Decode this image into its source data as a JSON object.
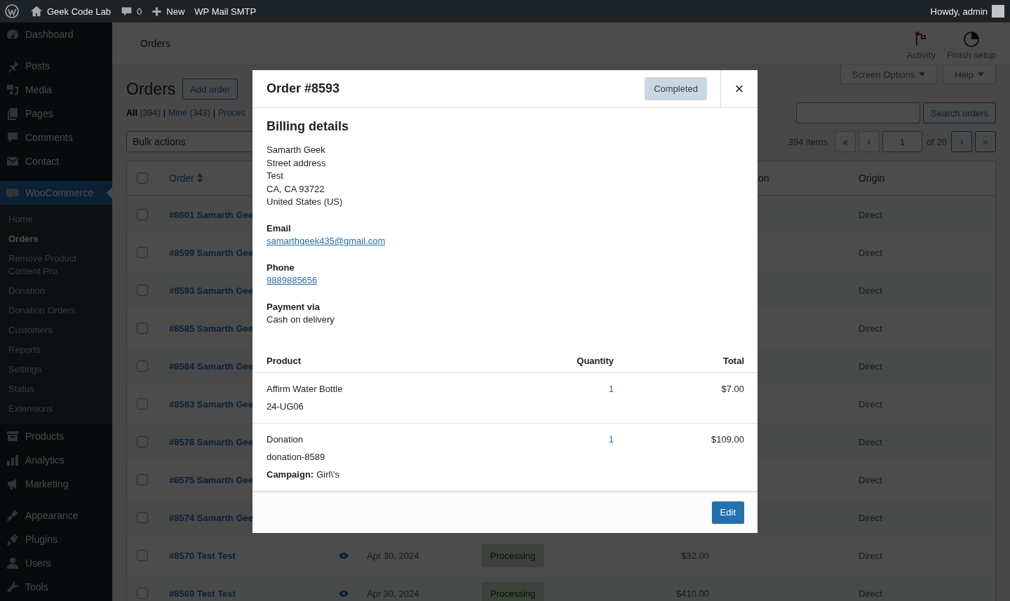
{
  "admin_bar": {
    "site": "Geek Code Lab",
    "comments": "0",
    "new": "New",
    "plugin": "WP Mail SMTP",
    "greeting": "Howdy, admin"
  },
  "sidebar": {
    "groups": [
      [
        {
          "label": "Dashboard",
          "selected": false
        }
      ],
      [
        {
          "label": "Posts",
          "selected": false
        },
        {
          "label": "Media",
          "selected": false
        },
        {
          "label": "Pages",
          "selected": false
        },
        {
          "label": "Comments",
          "selected": false
        },
        {
          "label": "Contact",
          "selected": false
        }
      ],
      [
        {
          "label": "WooCommerce",
          "selected": true,
          "children": [
            {
              "label": "Home",
              "selected": false
            },
            {
              "label": "Orders",
              "selected": true
            },
            {
              "label": "Remove Product Content Pro",
              "selected": false
            },
            {
              "label": "Donation",
              "selected": false
            },
            {
              "label": "Donation Orders",
              "selected": false
            },
            {
              "label": "Customers",
              "selected": false
            },
            {
              "label": "Reports",
              "selected": false
            },
            {
              "label": "Settings",
              "selected": false
            },
            {
              "label": "Status",
              "selected": false
            },
            {
              "label": "Extensions",
              "selected": false
            }
          ]
        },
        {
          "label": "Products",
          "selected": false
        },
        {
          "label": "Analytics",
          "selected": false
        },
        {
          "label": "Marketing",
          "selected": false
        }
      ],
      [
        {
          "label": "Appearance",
          "selected": false
        },
        {
          "label": "Plugins",
          "selected": false
        },
        {
          "label": "Users",
          "selected": false
        },
        {
          "label": "Tools",
          "selected": false
        }
      ]
    ]
  },
  "header": {
    "title": "Orders",
    "actions": [
      {
        "label": "Activity",
        "unread": true
      },
      {
        "label": "Finish setup",
        "unread": false
      }
    ]
  },
  "screen_meta": [
    "Screen Options",
    "Help"
  ],
  "page": {
    "title": "Orders",
    "add_button": "Add order"
  },
  "filters": {
    "separator": "|",
    "items": [
      {
        "label": "All",
        "count": "(394)",
        "selected": true
      },
      {
        "label": "Mine",
        "count": "(343)",
        "selected": false
      },
      {
        "label": "Proces",
        "selected": false
      }
    ]
  },
  "bulk_actions": "Bulk actions",
  "search": {
    "button": "Search orders"
  },
  "pagination": {
    "items": "394 items",
    "page": "1",
    "of": "of 20",
    "buttons": [
      {
        "label": "«",
        "disabled": true
      },
      {
        "label": "‹",
        "disabled": true
      },
      {
        "label": "›",
        "disabled": false
      },
      {
        "label": "»",
        "disabled": false
      }
    ]
  },
  "table": {
    "select_all_checked": false,
    "columns": [
      {
        "label": "Order",
        "sortable": true
      },
      {
        "label": "on"
      },
      {
        "label": "Origin"
      }
    ],
    "rows": [
      {
        "order": "#8601 Samarth Gee",
        "origin": "Direct",
        "checked": false
      },
      {
        "order": "#8599 Samarth Gee",
        "origin": "Direct",
        "checked": false
      },
      {
        "order": "#8593 Samarth Gee",
        "origin": "Direct",
        "checked": false
      },
      {
        "order": "#8585 Samarth Gee",
        "origin": "Direct",
        "checked": false
      },
      {
        "order": "#8584 Samarth Gee",
        "origin": "Direct",
        "checked": false
      },
      {
        "order": "#8583 Samarth Gee",
        "origin": "Direct",
        "checked": false
      },
      {
        "order": "#8576 Samarth Gee",
        "origin": "Direct",
        "checked": false
      },
      {
        "order": "#8575 Samarth Gee",
        "origin": "Direct",
        "checked": false
      },
      {
        "order": "#8574 Samarth Gee",
        "origin": "Direct",
        "checked": false
      },
      {
        "order": "#8570 Test Test",
        "date": "Apr 30, 2024",
        "status": "Processing",
        "total": "$32.00",
        "origin": "Direct",
        "checked": false
      },
      {
        "order": "#8569 Test Test",
        "date": "Apr 30, 2024",
        "status": "Processing",
        "total": "$410.00",
        "origin": "Direct",
        "checked": false
      }
    ]
  },
  "modal": {
    "title": "Order #8593",
    "status": "Completed",
    "close": "×",
    "billing_heading": "Billing details",
    "address": [
      "Samarth Geek",
      "Street address",
      "Test",
      "CA, CA 93722",
      "United States (US)"
    ],
    "fields": [
      {
        "label": "Email",
        "value": "samarthgeek435@gmail.com",
        "kind": "link"
      },
      {
        "label": "Phone",
        "value": "9889885656",
        "kind": "link"
      },
      {
        "label": "Payment via",
        "value": "Cash on delivery",
        "kind": "text"
      }
    ],
    "items_columns": [
      "Product",
      "Quantity",
      "Total"
    ],
    "items": [
      {
        "name": "Affirm Water Bottle",
        "sku": "24-UG06",
        "quantity": "1",
        "total": "$7.00"
      },
      {
        "name": "Donation",
        "sku": "donation-8589",
        "quantity": "1",
        "total": "$109.00",
        "meta_label": "Campaign:",
        "meta_value": "Girl\\'s"
      }
    ],
    "edit_button": "Edit"
  }
}
